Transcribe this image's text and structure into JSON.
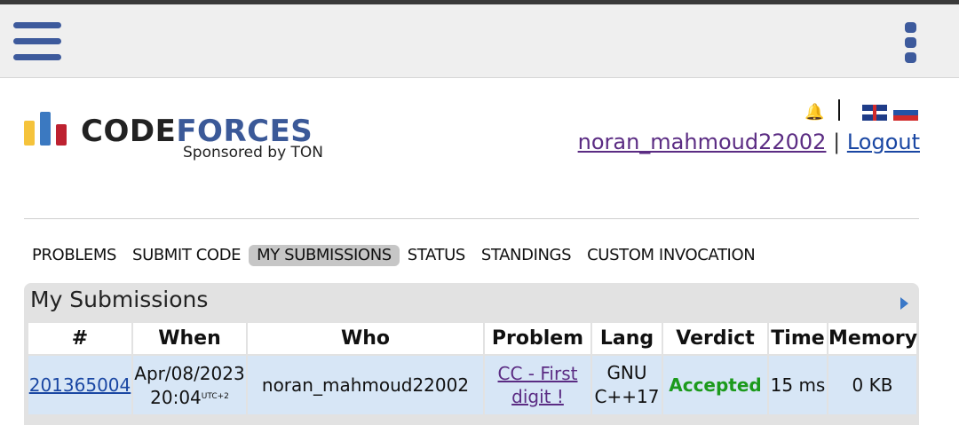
{
  "colors": {
    "accent": "#3d5a9c",
    "verdict_accepted": "#1c9a1c",
    "row_bg": "#d7e6f6",
    "panel_bg": "#e2e2e2"
  },
  "toolbar": {
    "menu_icon": "hamburger-menu-icon",
    "overflow_icon": "vertical-dots-icon"
  },
  "logo": {
    "word_code": "CODE",
    "word_forces": "FORCES",
    "sponsor": "Sponsored by TON"
  },
  "header": {
    "bell_icon": "bell-icon",
    "separator": "|",
    "username": "noran_mahmoud22002",
    "divider": "|",
    "logout": "Logout",
    "flags": [
      "english-flag",
      "russian-flag"
    ]
  },
  "menu": [
    "PROBLEMS",
    "SUBMIT CODE",
    "MY SUBMISSIONS",
    "STATUS",
    "STANDINGS",
    "CUSTOM INVOCATION"
  ],
  "menu_active": "MY SUBMISSIONS",
  "panel": {
    "title": "My Submissions",
    "arrow_icon": "right-triangle-icon"
  },
  "table": {
    "headers": [
      "#",
      "When",
      "Who",
      "Problem",
      "Lang",
      "Verdict",
      "Time",
      "Memory"
    ],
    "rows": [
      {
        "id": "201365004",
        "date": "Apr/08/2023",
        "time": "20:04",
        "tz": "UTC+2",
        "who": "noran_mahmoud22002",
        "problem_line1": "CC - First",
        "problem_line2": "digit !",
        "lang_line1": "GNU",
        "lang_line2": "C++17",
        "verdict": "Accepted",
        "exec_time": "15 ms",
        "memory": "0 KB"
      }
    ]
  }
}
